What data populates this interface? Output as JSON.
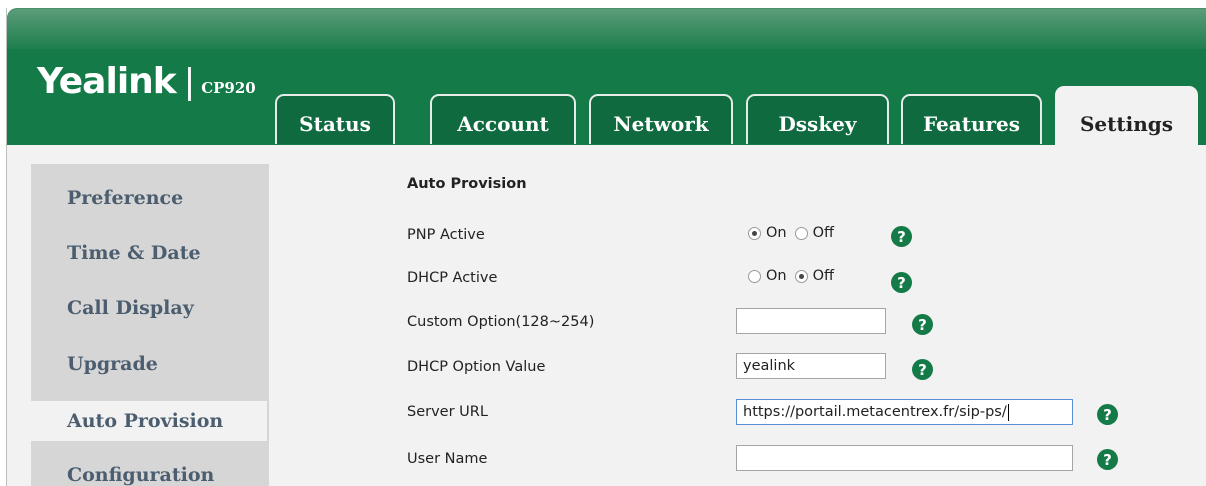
{
  "brand": {
    "name": "Yealink",
    "separator": "|",
    "model": "CP920"
  },
  "tabs": [
    {
      "label": "Status",
      "active": false
    },
    {
      "label": "Account",
      "active": false
    },
    {
      "label": "Network",
      "active": false
    },
    {
      "label": "Dsskey",
      "active": false
    },
    {
      "label": "Features",
      "active": false
    },
    {
      "label": "Settings",
      "active": true
    }
  ],
  "sidebar": {
    "items": [
      {
        "label": "Preference"
      },
      {
        "label": "Time & Date"
      },
      {
        "label": "Call Display"
      },
      {
        "label": "Upgrade"
      },
      {
        "label": "Auto Provision",
        "active": true
      },
      {
        "label": "Configuration"
      }
    ]
  },
  "form": {
    "section_title": "Auto Provision",
    "pnp_active": {
      "label": "PNP Active",
      "on_label": "On",
      "off_label": "Off",
      "selected": "On"
    },
    "dhcp_active": {
      "label": "DHCP Active",
      "on_label": "On",
      "off_label": "Off",
      "selected": "Off"
    },
    "custom_option": {
      "label": "Custom Option(128~254)",
      "value": ""
    },
    "dhcp_option_value": {
      "label": "DHCP Option Value",
      "value": "yealink"
    },
    "server_url": {
      "label": "Server URL",
      "value": "https://portail.metacentrex.fr/sip-ps/"
    },
    "user_name": {
      "label": "User Name",
      "value": ""
    },
    "help_glyph": "?"
  },
  "colors": {
    "header_green": "#137a48",
    "content_bg": "#f2f2f2",
    "sidebar_bg": "#d6d6d6",
    "sidebar_text": "#4b5d6e"
  }
}
